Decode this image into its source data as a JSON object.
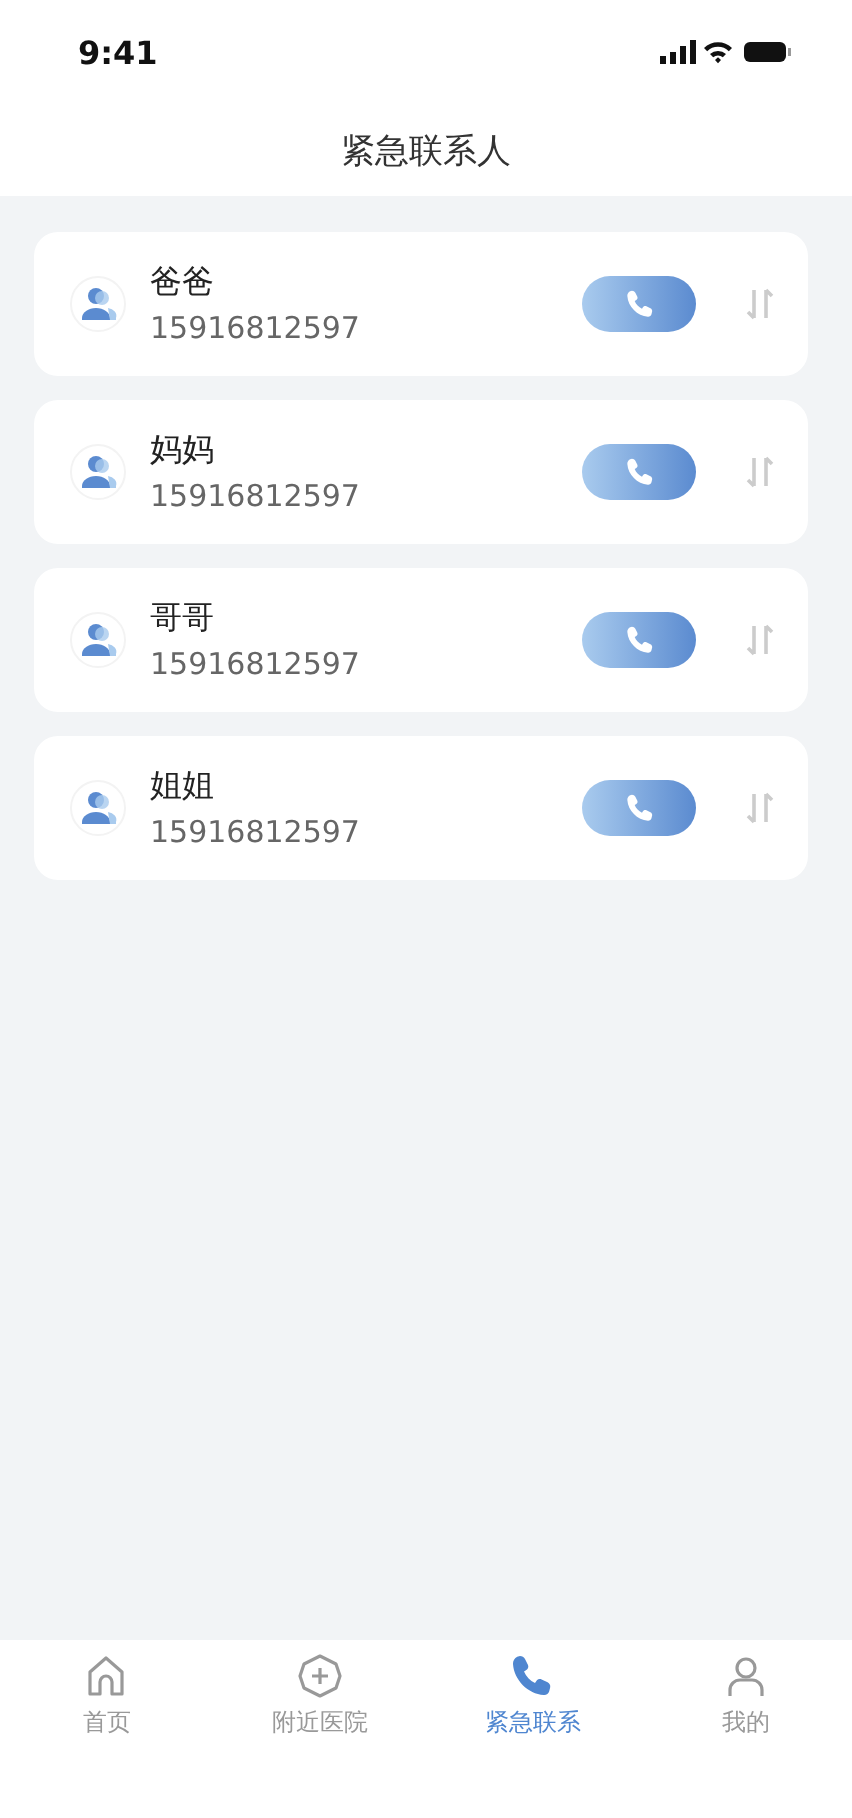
{
  "status_bar": {
    "time": "9:41"
  },
  "header": {
    "title": "紧急联系人"
  },
  "contacts": [
    {
      "name": "爸爸",
      "phone": "15916812597"
    },
    {
      "name": "妈妈",
      "phone": "15916812597"
    },
    {
      "name": "哥哥",
      "phone": "15916812597"
    },
    {
      "name": "姐姐",
      "phone": "15916812597"
    }
  ],
  "tab_bar": [
    {
      "kind": "home",
      "label": "首页",
      "selected": false
    },
    {
      "kind": "hospital",
      "label": "附近医院",
      "selected": false
    },
    {
      "kind": "phone",
      "label": "紧急联系",
      "selected": true
    },
    {
      "kind": "profile",
      "label": "我的",
      "selected": false
    }
  ]
}
